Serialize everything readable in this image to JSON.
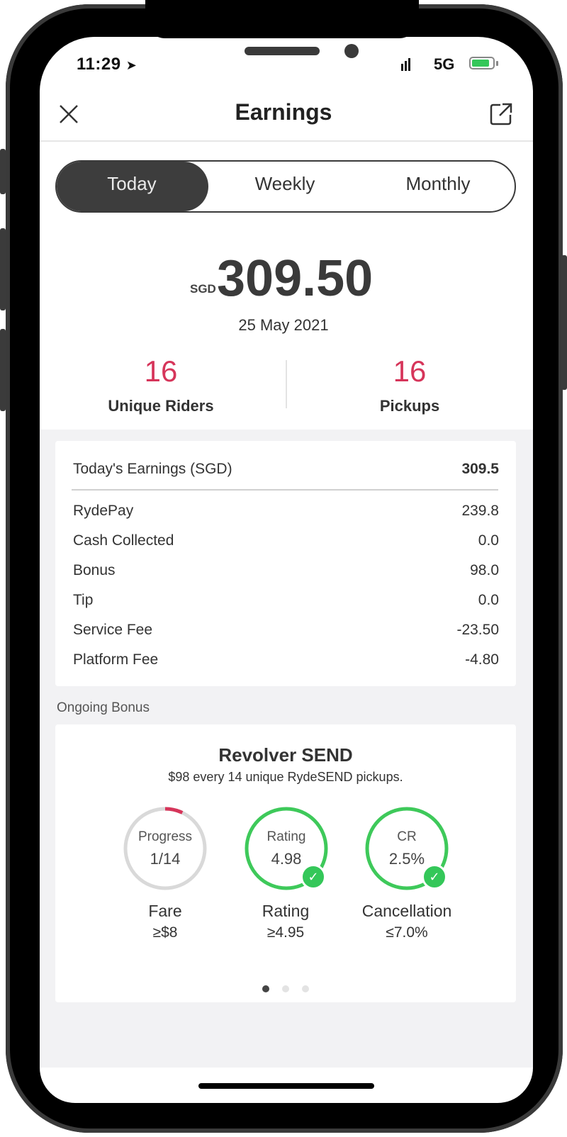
{
  "status": {
    "time": "11:29",
    "network": "5G"
  },
  "header": {
    "title": "Earnings"
  },
  "tabs": [
    "Today",
    "Weekly",
    "Monthly"
  ],
  "summary": {
    "currency": "SGD",
    "amount": "309.50",
    "date": "25 May 2021"
  },
  "stats": [
    {
      "value": "16",
      "label": "Unique Riders"
    },
    {
      "value": "16",
      "label": "Pickups"
    }
  ],
  "earnings": {
    "title": "Today's Earnings (SGD)",
    "total": "309.5",
    "rows": [
      {
        "label": "RydePay",
        "value": "239.8"
      },
      {
        "label": "Cash Collected",
        "value": "0.0"
      },
      {
        "label": "Bonus",
        "value": "98.0"
      },
      {
        "label": "Tip",
        "value": "0.0"
      },
      {
        "label": "Service Fee",
        "value": "-23.50"
      },
      {
        "label": "Platform Fee",
        "value": "-4.80"
      }
    ]
  },
  "bonus": {
    "section_label": "Ongoing Bonus",
    "title": "Revolver SEND",
    "subtitle": "$98 every 14 unique RydeSEND pickups.",
    "metrics": [
      {
        "ring_label": "Progress",
        "ring_value": "1/14",
        "name": "Fare",
        "requirement": "≥$8",
        "progress": 0.0714,
        "met": false
      },
      {
        "ring_label": "Rating",
        "ring_value": "4.98",
        "name": "Rating",
        "requirement": "≥4.95",
        "progress": 1,
        "met": true
      },
      {
        "ring_label": "CR",
        "ring_value": "2.5%",
        "name": "Cancellation",
        "requirement": "≤7.0%",
        "progress": 1,
        "met": true
      }
    ],
    "pager": {
      "pages": 3,
      "active": 1
    }
  },
  "colors": {
    "accent": "#d6355a",
    "success": "#34c759",
    "dark": "#3d3d3d"
  }
}
